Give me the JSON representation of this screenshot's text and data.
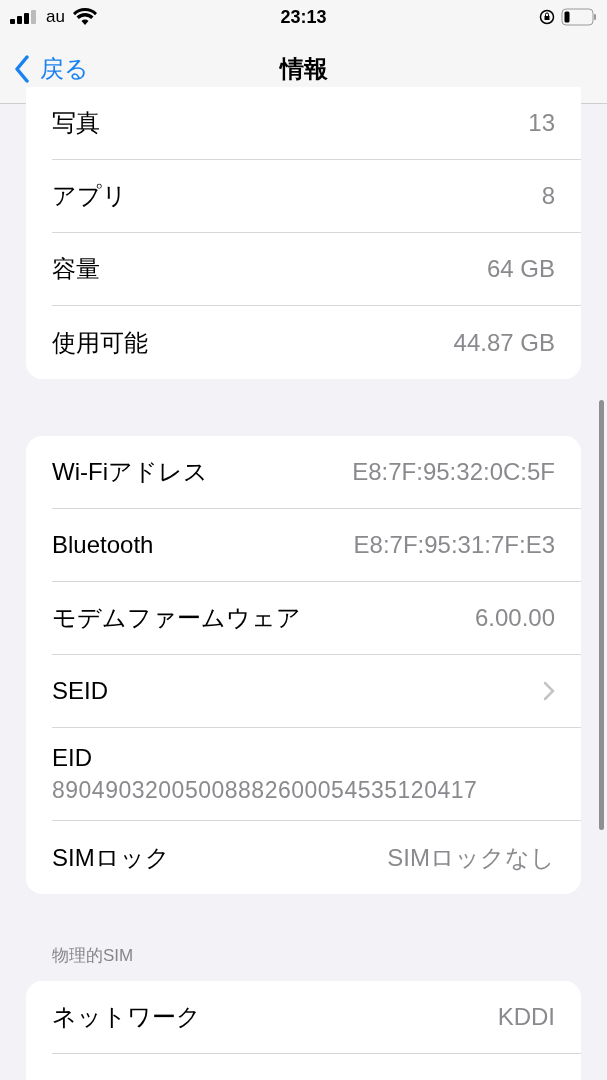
{
  "status_bar": {
    "carrier": "au",
    "time": "23:13"
  },
  "nav": {
    "back": "戻る",
    "title": "情報"
  },
  "groups": [
    {
      "rows": [
        {
          "kind": "value",
          "label": "写真",
          "value": "13"
        },
        {
          "kind": "value",
          "label": "アプリ",
          "value": "8"
        },
        {
          "kind": "value",
          "label": "容量",
          "value": "64 GB"
        },
        {
          "kind": "value",
          "label": "使用可能",
          "value": "44.87 GB"
        }
      ]
    },
    {
      "rows": [
        {
          "kind": "value",
          "label": "Wi-Fiアドレス",
          "value": "E8:7F:95:32:0C:5F"
        },
        {
          "kind": "value",
          "label": "Bluetooth",
          "value": "E8:7F:95:31:7F:E3"
        },
        {
          "kind": "value",
          "label": "モデムファームウェア",
          "value": "6.00.00"
        },
        {
          "kind": "chevron",
          "label": "SEID"
        },
        {
          "kind": "stacked",
          "label": "EID",
          "value": "89049032005008882600054535120417"
        },
        {
          "kind": "value",
          "label": "SIMロック",
          "value": "SIMロックなし"
        }
      ]
    },
    {
      "header": "物理的SIM",
      "rows": [
        {
          "kind": "value",
          "label": "ネットワーク",
          "value": "KDDI"
        }
      ]
    }
  ]
}
